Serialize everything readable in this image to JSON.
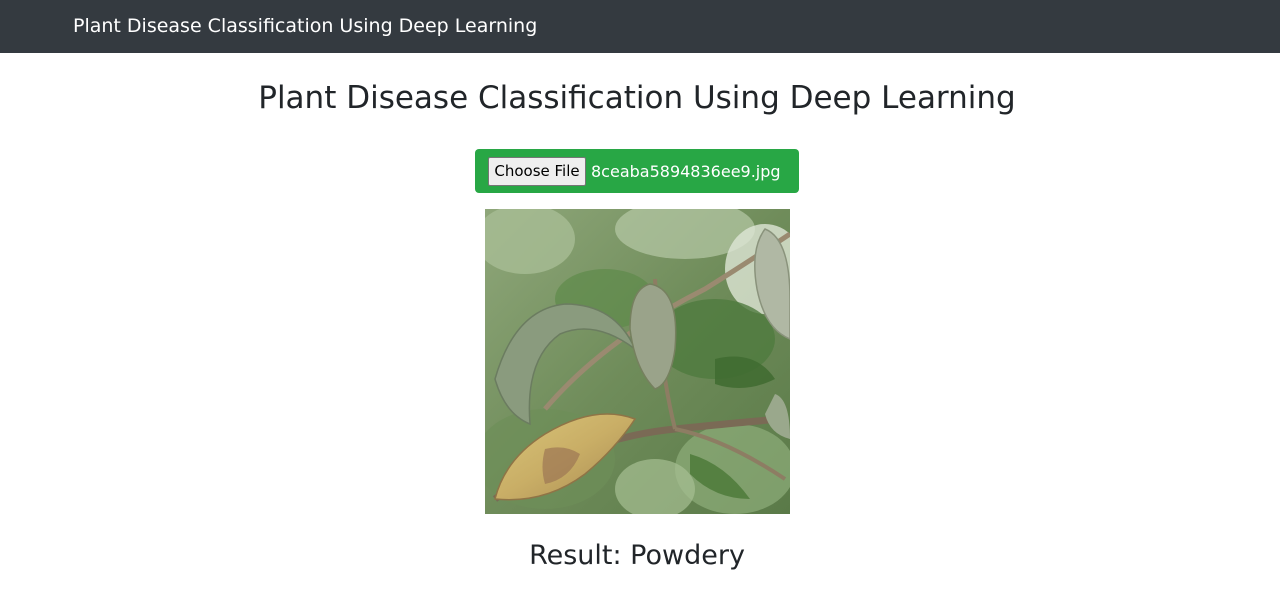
{
  "navbar": {
    "brand": "Plant Disease Classification Using Deep Learning"
  },
  "main": {
    "title": "Plant Disease Classification Using Deep Learning",
    "upload": {
      "button_label": "Choose File",
      "file_name": "8ceaba5894836ee9.jpg",
      "background_color": "#28a745"
    },
    "result_text": "Result: Powdery"
  },
  "colors": {
    "navbar_bg": "#343a40",
    "text": "#212529",
    "upload_bg": "#28a745"
  }
}
